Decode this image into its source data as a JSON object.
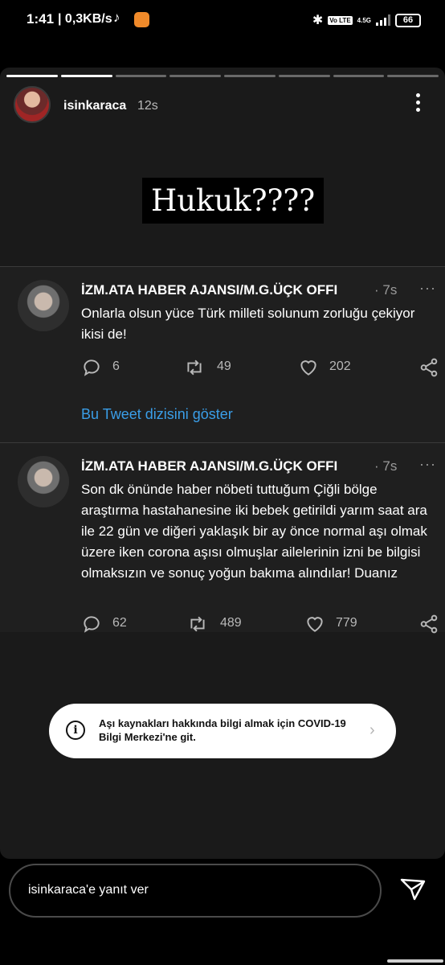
{
  "status_bar": {
    "time": "1:41",
    "speed": "| 0,3KB/s",
    "volte": "Vo LTE",
    "network": "4.5G",
    "battery": "66"
  },
  "story": {
    "progress_total": 8,
    "progress_done": 2,
    "username": "isinkaraca",
    "time_ago": "12s",
    "caption": "Hukuk????"
  },
  "tweets": [
    {
      "name": "İZM.ATA HABER AJANSI/M.G.ÜÇK OFFI",
      "time": "· 7s",
      "text": "Onlarla olsun yüce Türk milleti solunum zorluğu çekiyor ikisi de!",
      "replies": "6",
      "retweets": "49",
      "likes": "202",
      "thread_link": "Bu Tweet dizisini göster"
    },
    {
      "name": "İZM.ATA HABER AJANSI/M.G.ÜÇK OFFI",
      "time": "· 7s",
      "text": "Son dk önünde haber nöbeti tuttuğum Çiğli bölge araştırma hastahanesine iki bebek getirildi yarım saat ara ile 22 gün ve diğeri yaklaşık bir ay önce normal aşı olmak üzere iken  corona aşısı olmuşlar ailelerinin izni be bilgisi olmaksızın ve sonuç yoğun bakıma alındılar! Duanız",
      "replies": "62",
      "retweets": "489",
      "likes": "779"
    }
  ],
  "banner": {
    "text": "Aşı kaynakları hakkında bilgi almak için COVID-19 Bilgi Merkezi'ne git."
  },
  "reply_bar": {
    "placeholder": "isinkaraca'e yanıt ver"
  },
  "colors": {
    "link": "#3a9ee8",
    "story_bg": "#1a1a1a",
    "tweet_bg": "#1f1f1f"
  }
}
